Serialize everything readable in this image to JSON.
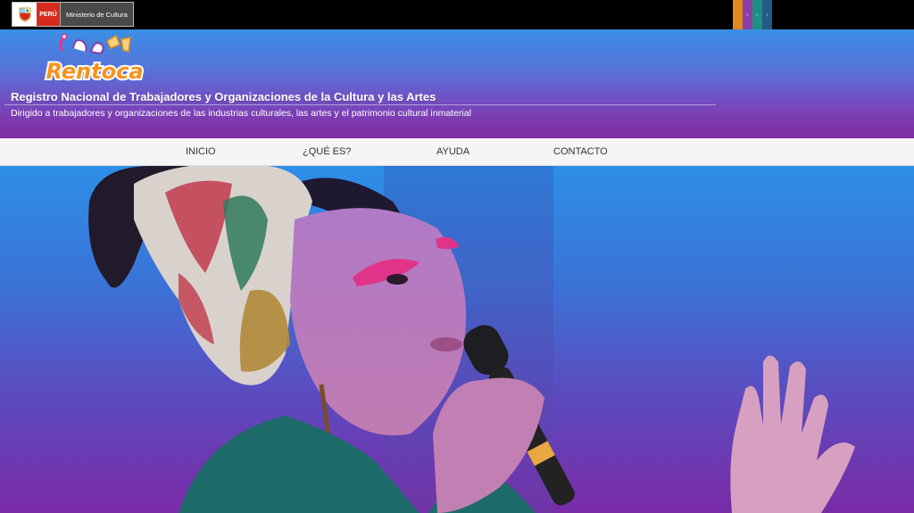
{
  "gov_bar": {
    "peru_label": "PERÚ",
    "ministry_label": "Ministerio de Cultura"
  },
  "color_tabs": [
    {
      "color": "#e08a1e",
      "glyph": ""
    },
    {
      "color": "#8a3ea8",
      "glyph": "‹"
    },
    {
      "color": "#1f8f84",
      "glyph": "‹"
    },
    {
      "color": "#235b86",
      "glyph": "‹"
    }
  ],
  "header": {
    "logo_text": "Rentoca",
    "title": "Registro Nacional de Trabajadores y Organizaciones de la Cultura y las Artes",
    "subtitle": "Dirigido a trabajadores y organizaciones de las industrias culturales, las artes y el patrimonio cultural inmaterial"
  },
  "nav": {
    "items": [
      {
        "label": "INICIO"
      },
      {
        "label": "¿QUÉ ES?"
      },
      {
        "label": "AYUDA"
      },
      {
        "label": "CONTACTO"
      }
    ]
  },
  "hero": {
    "image_subject": "woman-singing-with-microphone"
  }
}
